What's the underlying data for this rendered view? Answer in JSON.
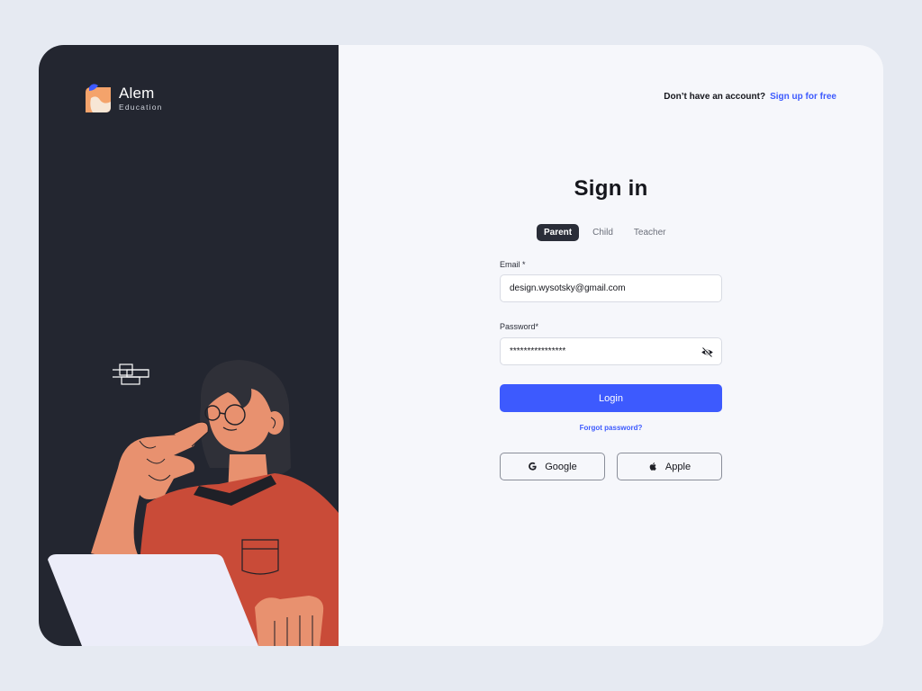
{
  "brand": {
    "name": "Alem",
    "subtitle": "Education"
  },
  "header": {
    "signup_prompt": "Don’t have an account?",
    "signup_link": "Sign up for free"
  },
  "form": {
    "title": "Sign in",
    "tabs": [
      {
        "label": "Parent",
        "active": true
      },
      {
        "label": "Child",
        "active": false
      },
      {
        "label": "Teacher",
        "active": false
      }
    ],
    "email_label": "Email *",
    "email_value": "design.wysotsky@gmail.com",
    "password_label": "Password*",
    "password_value": "****************",
    "login_label": "Login",
    "forgot_label": "Forgot password?",
    "google_label": "Google",
    "apple_label": "Apple"
  },
  "colors": {
    "accent": "#3d5afe",
    "dark_panel": "#232630",
    "page_bg": "#e6eaf2",
    "card_bg": "#f6f7fb"
  },
  "icons": [
    "logo-icon",
    "eye-off-icon",
    "google-icon",
    "apple-icon"
  ]
}
